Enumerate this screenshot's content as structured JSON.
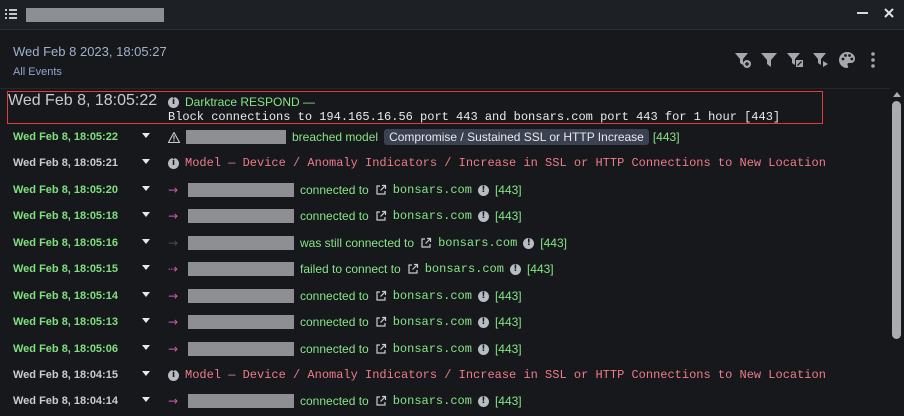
{
  "window": {
    "controls": {
      "minimize": "minimize",
      "close": "close"
    }
  },
  "header": {
    "datetime": "Wed Feb 8 2023, 18:05:27",
    "events_link": "All Events"
  },
  "toolbar": {
    "icons": [
      "add-filter-icon",
      "filter-icon",
      "edit-filter-icon",
      "filter-settings-icon",
      "palette-icon",
      "more-vertical-icon"
    ]
  },
  "events": [
    {
      "time": "Wed Feb 8, 18:05:22",
      "type": "respond",
      "title": "Darktrace RESPOND —",
      "detail": "Block connections to 194.165.16.56 port 443 and bonsars.com port 443 for 1 hour [443]"
    },
    {
      "time": "Wed Feb 8, 18:05:22",
      "type": "breach",
      "verb": "breached model",
      "model": "Compromise / Sustained SSL or HTTP Increase",
      "port": "[443]"
    },
    {
      "time": "Wed Feb 8, 18:05:21",
      "type": "model",
      "text": "Model — Device / Anomaly Indicators / Increase in SSL or HTTP Connections to New Location"
    },
    {
      "time": "Wed Feb 8, 18:05:20",
      "type": "conn",
      "verb": "connected to",
      "domain": "bonsars.com",
      "port": "[443]"
    },
    {
      "time": "Wed Feb 8, 18:05:18",
      "type": "conn",
      "verb": "connected to",
      "domain": "bonsars.com",
      "port": "[443]"
    },
    {
      "time": "Wed Feb 8, 18:05:16",
      "type": "conn",
      "verb": "was still connected to",
      "domain": "bonsars.com",
      "port": "[443]"
    },
    {
      "time": "Wed Feb 8, 18:05:15",
      "type": "conn",
      "verb": "failed to connect to",
      "domain": "bonsars.com",
      "port": "[443]"
    },
    {
      "time": "Wed Feb 8, 18:05:14",
      "type": "conn",
      "verb": "connected to",
      "domain": "bonsars.com",
      "port": "[443]"
    },
    {
      "time": "Wed Feb 8, 18:05:13",
      "type": "conn",
      "verb": "connected to",
      "domain": "bonsars.com",
      "port": "[443]"
    },
    {
      "time": "Wed Feb 8, 18:05:06",
      "type": "conn",
      "verb": "connected to",
      "domain": "bonsars.com",
      "port": "[443]"
    },
    {
      "time": "Wed Feb 8, 18:04:15",
      "type": "model",
      "text": "Model — Device / Anomaly Indicators / Increase in SSL or HTTP Connections to New Location"
    },
    {
      "time": "Wed Feb 8, 18:04:14",
      "type": "conn",
      "verb": "connected to",
      "domain": "bonsars.com",
      "port": "[443]"
    }
  ],
  "colors": {
    "accent_green": "#86e586",
    "model_red": "#ef7b8b",
    "highlight_border": "#e23b3b",
    "arrow_magenta": "#d05ab0"
  }
}
